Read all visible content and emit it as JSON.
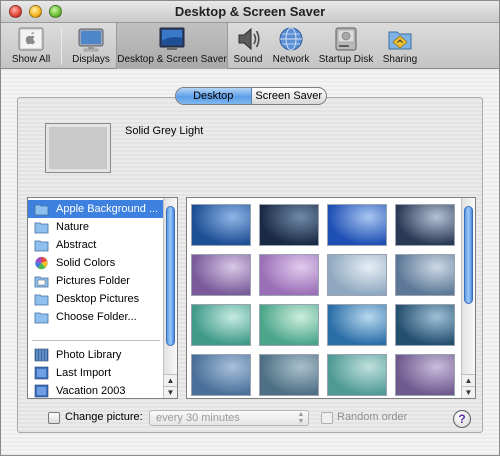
{
  "window": {
    "title": "Desktop & Screen Saver"
  },
  "toolbar": {
    "items": [
      {
        "label": "Show All",
        "icon": "apple-icon"
      },
      {
        "label": "Displays",
        "icon": "display-icon"
      },
      {
        "label": "Desktop & Screen Saver",
        "icon": "desktop-icon",
        "selected": true
      },
      {
        "label": "Sound",
        "icon": "speaker-icon"
      },
      {
        "label": "Network",
        "icon": "globe-icon"
      },
      {
        "label": "Startup Disk",
        "icon": "hard-disk-icon"
      },
      {
        "label": "Sharing",
        "icon": "sharing-folder-icon"
      }
    ]
  },
  "tabs": [
    {
      "label": "Desktop",
      "active": true
    },
    {
      "label": "Screen Saver",
      "active": false
    }
  ],
  "preview": {
    "name": "Solid Grey Light",
    "color": "#c9c9c9"
  },
  "sources": {
    "items": [
      {
        "label": "Apple Background ...",
        "icon": "folder-icon",
        "selected": true
      },
      {
        "label": "Nature",
        "icon": "folder-icon"
      },
      {
        "label": "Abstract",
        "icon": "folder-icon"
      },
      {
        "label": "Solid Colors",
        "icon": "color-wheel-icon"
      },
      {
        "label": "Pictures Folder",
        "icon": "pictures-folder-icon"
      },
      {
        "label": "Desktop Pictures",
        "icon": "folder-icon"
      },
      {
        "label": "Choose Folder...",
        "icon": "folder-icon"
      }
    ],
    "library": [
      {
        "label": "Photo Library",
        "icon": "photo-library-icon"
      },
      {
        "label": "Last Import",
        "icon": "album-icon"
      },
      {
        "label": "Vacation 2003",
        "icon": "album-icon"
      }
    ]
  },
  "thumbnails": [
    {
      "c1": "#1d4f95",
      "c2": "#8fb6e6"
    },
    {
      "c1": "#1b2a44",
      "c2": "#6f8aa8"
    },
    {
      "c1": "#1e4fb5",
      "c2": "#a8c6f0"
    },
    {
      "c1": "#2a3a55",
      "c2": "#b2c2d6"
    },
    {
      "c1": "#7a5a9a",
      "c2": "#d8c8e6"
    },
    {
      "c1": "#9b6fb8",
      "c2": "#e2cbee"
    },
    {
      "c1": "#8fa8c0",
      "c2": "#e6eef5"
    },
    {
      "c1": "#5c7896",
      "c2": "#cdd9e6"
    },
    {
      "c1": "#3f9a88",
      "c2": "#c6ebe2"
    },
    {
      "c1": "#4aa58a",
      "c2": "#cdeedd"
    },
    {
      "c1": "#2a6ea8",
      "c2": "#b8d8ee"
    },
    {
      "c1": "#24506e",
      "c2": "#9fbfd6"
    },
    {
      "c1": "#4a6f9a",
      "c2": "#a8c0da"
    },
    {
      "c1": "#4e6f84",
      "c2": "#a9c0cc"
    },
    {
      "c1": "#4f9a95",
      "c2": "#bfe0dc"
    },
    {
      "c1": "#6f5a8e",
      "c2": "#c9bcdc"
    }
  ],
  "options": {
    "change_picture_label": "Change picture:",
    "interval_value": "every 30 minutes",
    "random_label": "Random order",
    "help_label": "?"
  },
  "colors": {
    "accent": "#3d80df",
    "selection": "#3d80df"
  }
}
